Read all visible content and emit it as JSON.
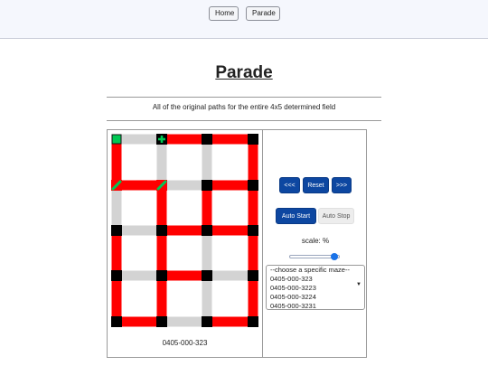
{
  "nav": {
    "home_label": "Home",
    "parade_label": "Parade"
  },
  "page": {
    "title": "Parade",
    "subtitle": "All of the original paths for the entire 4x5 determined field"
  },
  "maze": {
    "id": "0405-000-323",
    "colors": {
      "path": "#ff0000",
      "wall": "#d3d3d3",
      "node": "#000000",
      "marker": "#00c853"
    }
  },
  "controls": {
    "prev_label": "<<<",
    "reset_label": "Reset",
    "next_label": ">>>",
    "auto_start_label": "Auto Start",
    "auto_stop_label": "Auto Stop",
    "scale_label": "scale: %",
    "scale_value": 0.95
  },
  "maze_select": {
    "options": [
      "--choose a specific maze--",
      "0405-000-323",
      "0405-000-3223",
      "0405-000-3224",
      "0405-000-3231"
    ]
  },
  "colors": {
    "accent": "#0d47a1",
    "topbar_bg": "#f5f7fd"
  }
}
